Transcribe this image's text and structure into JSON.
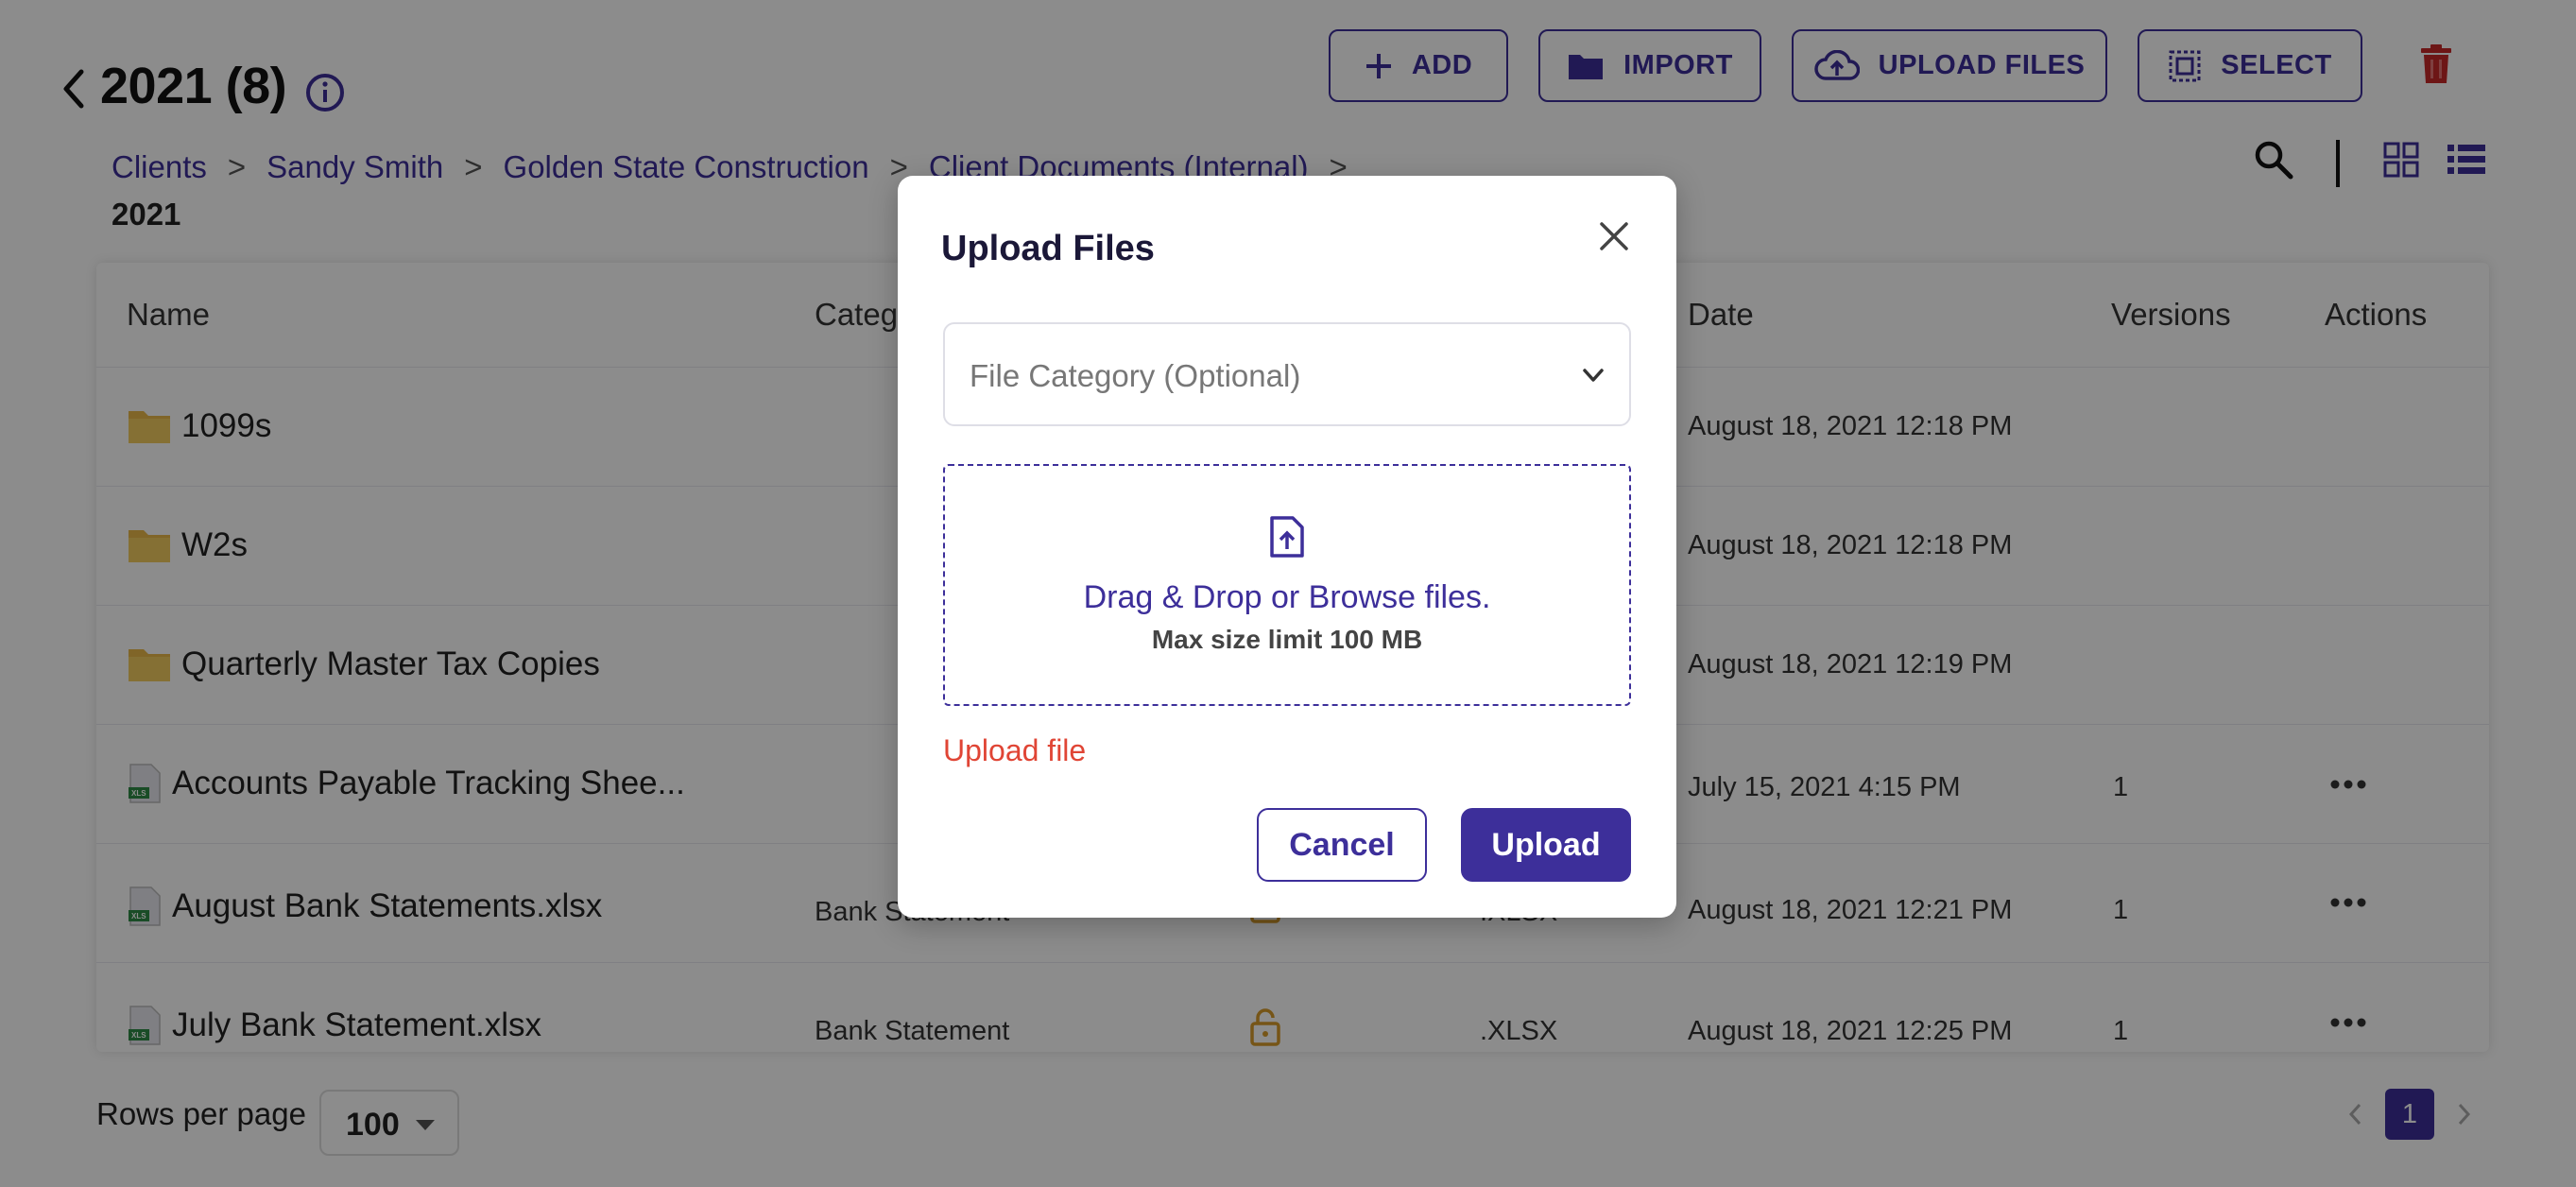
{
  "header": {
    "title": "2021 (8)",
    "buttons": {
      "add": "ADD",
      "import": "IMPORT",
      "upload_files": "UPLOAD FILES",
      "select": "SELECT"
    }
  },
  "breadcrumb": {
    "items": [
      "Clients",
      "Sandy Smith",
      "Golden State Construction",
      "Client Documents (Internal)"
    ],
    "separator": ">",
    "current": "2021"
  },
  "table": {
    "columns": [
      "Name",
      "Category",
      "Date",
      "Versions",
      "Actions"
    ],
    "rows": [
      {
        "name": "1099s",
        "type": "folder",
        "category": "",
        "ext": "",
        "date": "August 18, 2021 12:18 PM",
        "versions": ""
      },
      {
        "name": "W2s",
        "type": "folder",
        "category": "",
        "ext": "",
        "date": "August 18, 2021 12:18 PM",
        "versions": ""
      },
      {
        "name": "Quarterly Master Tax Copies",
        "type": "folder",
        "category": "",
        "ext": "",
        "date": "August 18, 2021 12:19 PM",
        "versions": ""
      },
      {
        "name": "Accounts Payable Tracking Shee...",
        "type": "xls",
        "category": "",
        "ext": "",
        "date": "July 15, 2021 4:15 PM",
        "versions": "1"
      },
      {
        "name": "August Bank Statements.xlsx",
        "type": "xls",
        "category": "Bank Statement",
        "ext": ".XLSX",
        "date": "August 18, 2021 12:21 PM",
        "versions": "1"
      },
      {
        "name": "July Bank Statement.xlsx",
        "type": "xls",
        "category": "Bank Statement",
        "ext": ".XLSX",
        "date": "August 18, 2021 12:25 PM",
        "versions": "1"
      }
    ]
  },
  "footer": {
    "rows_per_page_label": "Rows per page",
    "rows_per_page_value": "100",
    "current_page": "1"
  },
  "modal": {
    "title": "Upload Files",
    "category_placeholder": "File Category (Optional)",
    "drop_text": "Drag & Drop or Browse files.",
    "size_limit": "Max size limit 100 MB",
    "error": "Upload file",
    "cancel": "Cancel",
    "upload": "Upload"
  },
  "colors": {
    "accent": "#3d2f9a",
    "danger": "#c62828",
    "error_text": "#e04535",
    "lock": "#d89b2b"
  },
  "icons": [
    "back-icon",
    "info-icon",
    "plus-icon",
    "folder-icon",
    "cloud-upload-icon",
    "select-icon",
    "trash-icon",
    "search-icon",
    "grid-view-icon",
    "list-view-icon",
    "xls-file-icon",
    "lock-icon",
    "more-icon",
    "close-icon",
    "chevron-down-icon",
    "file-upload-icon"
  ]
}
